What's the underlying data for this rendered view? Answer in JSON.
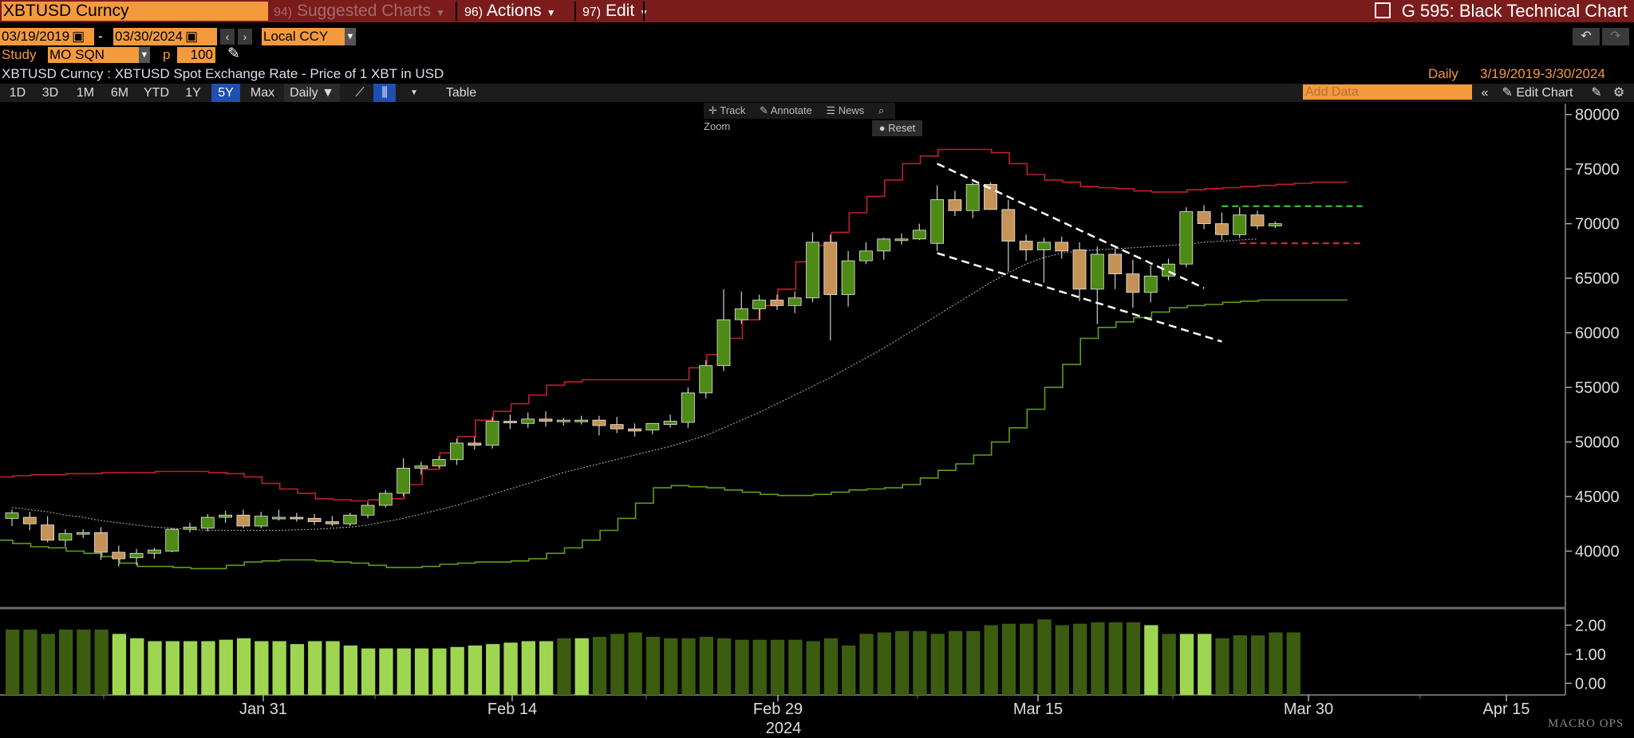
{
  "header": {
    "ticker": "XBTUSD Curncy",
    "menus": [
      {
        "num": "94)",
        "label": "Suggested Charts"
      },
      {
        "num": "96)",
        "label": "Actions"
      },
      {
        "num": "97)",
        "label": "Edit"
      }
    ],
    "function_title": "G 595: Black Technical Chart"
  },
  "controls": {
    "start_date": "03/19/2019",
    "date_sep": "-",
    "end_date": "03/30/2024",
    "currency": "Local CCY",
    "study_label": "Study",
    "study_value": "MO SQN",
    "p_label": "p",
    "p_value": "100",
    "undo": "↶",
    "redo": "↷"
  },
  "security_desc": "XBTUSD Curncy : XBTUSD Spot Exchange Rate - Price of 1 XBT in USD",
  "period_info": {
    "frequency": "Daily",
    "range": "3/19/2019-3/30/2024"
  },
  "toolbar": {
    "periods": [
      "1D",
      "3D",
      "1M",
      "6M",
      "YTD",
      "1Y",
      "5Y",
      "Max"
    ],
    "selected": "5Y",
    "frequency": "Daily ▼",
    "table": "Table",
    "add_data_placeholder": "Add Data",
    "edit_chart": "Edit Chart"
  },
  "chart_tools": {
    "track": "Track",
    "annotate": "Annotate",
    "news": "News",
    "zoom": "Zoom",
    "reset": "Reset"
  },
  "watermark": "MACRO OPS",
  "chart_data": {
    "type": "candlestick",
    "x_tick_labels": [
      "Jan 31",
      "Feb 14",
      "Feb 29",
      "Mar 15",
      "Mar 30",
      "Apr 15"
    ],
    "x_year_label": "2024",
    "y_ticks": [
      40000,
      45000,
      50000,
      55000,
      60000,
      65000,
      70000,
      75000,
      80000
    ],
    "ylim": [
      35000,
      81000
    ],
    "candles": [
      {
        "o": 43000,
        "h": 43800,
        "l": 42300,
        "c": 43500
      },
      {
        "o": 43100,
        "h": 43600,
        "l": 41900,
        "c": 42500
      },
      {
        "o": 42400,
        "h": 43200,
        "l": 40800,
        "c": 41000
      },
      {
        "o": 41000,
        "h": 42000,
        "l": 40400,
        "c": 41600
      },
      {
        "o": 41600,
        "h": 42000,
        "l": 41200,
        "c": 41700
      },
      {
        "o": 41700,
        "h": 42200,
        "l": 39200,
        "c": 39900
      },
      {
        "o": 39900,
        "h": 40500,
        "l": 38600,
        "c": 39300
      },
      {
        "o": 39400,
        "h": 40200,
        "l": 38700,
        "c": 39800
      },
      {
        "o": 39800,
        "h": 40300,
        "l": 39300,
        "c": 40100
      },
      {
        "o": 40000,
        "h": 42100,
        "l": 39900,
        "c": 42000
      },
      {
        "o": 42000,
        "h": 42600,
        "l": 41700,
        "c": 42200
      },
      {
        "o": 42100,
        "h": 43400,
        "l": 41800,
        "c": 43100
      },
      {
        "o": 43100,
        "h": 43700,
        "l": 42600,
        "c": 43300
      },
      {
        "o": 43300,
        "h": 43800,
        "l": 42100,
        "c": 42300
      },
      {
        "o": 42300,
        "h": 43600,
        "l": 42100,
        "c": 43200
      },
      {
        "o": 43100,
        "h": 43800,
        "l": 42800,
        "c": 43100
      },
      {
        "o": 43100,
        "h": 43500,
        "l": 42700,
        "c": 43000
      },
      {
        "o": 43000,
        "h": 43400,
        "l": 42400,
        "c": 42700
      },
      {
        "o": 42700,
        "h": 43200,
        "l": 42300,
        "c": 42500
      },
      {
        "o": 42500,
        "h": 43500,
        "l": 42300,
        "c": 43300
      },
      {
        "o": 43300,
        "h": 44500,
        "l": 43000,
        "c": 44200
      },
      {
        "o": 44200,
        "h": 45600,
        "l": 44000,
        "c": 45300
      },
      {
        "o": 45300,
        "h": 48500,
        "l": 45000,
        "c": 47600
      },
      {
        "o": 47600,
        "h": 48200,
        "l": 47000,
        "c": 47800
      },
      {
        "o": 47800,
        "h": 48700,
        "l": 47600,
        "c": 48400
      },
      {
        "o": 48400,
        "h": 50300,
        "l": 47900,
        "c": 49900
      },
      {
        "o": 49900,
        "h": 50500,
        "l": 49300,
        "c": 49700
      },
      {
        "o": 49700,
        "h": 52300,
        "l": 49400,
        "c": 51900
      },
      {
        "o": 51900,
        "h": 52500,
        "l": 51200,
        "c": 51800
      },
      {
        "o": 51700,
        "h": 52700,
        "l": 51300,
        "c": 52100
      },
      {
        "o": 52100,
        "h": 52800,
        "l": 51400,
        "c": 51900
      },
      {
        "o": 51900,
        "h": 52200,
        "l": 51500,
        "c": 52000
      },
      {
        "o": 52000,
        "h": 52400,
        "l": 51600,
        "c": 52000
      },
      {
        "o": 52000,
        "h": 52400,
        "l": 50600,
        "c": 51500
      },
      {
        "o": 51600,
        "h": 52300,
        "l": 50800,
        "c": 51200
      },
      {
        "o": 51200,
        "h": 51700,
        "l": 50500,
        "c": 51000
      },
      {
        "o": 51100,
        "h": 51500,
        "l": 50700,
        "c": 51700
      },
      {
        "o": 51600,
        "h": 52500,
        "l": 51300,
        "c": 51900
      },
      {
        "o": 51800,
        "h": 55000,
        "l": 51300,
        "c": 54500
      },
      {
        "o": 54500,
        "h": 57500,
        "l": 54000,
        "c": 57000
      },
      {
        "o": 57000,
        "h": 64000,
        "l": 56500,
        "c": 61200
      },
      {
        "o": 61200,
        "h": 63800,
        "l": 60800,
        "c": 62200
      },
      {
        "o": 62200,
        "h": 63500,
        "l": 61200,
        "c": 63000
      },
      {
        "o": 63000,
        "h": 63500,
        "l": 62100,
        "c": 62500
      },
      {
        "o": 62500,
        "h": 63800,
        "l": 61800,
        "c": 63200
      },
      {
        "o": 63200,
        "h": 69200,
        "l": 62800,
        "c": 68300
      },
      {
        "o": 68300,
        "h": 69000,
        "l": 59300,
        "c": 63500
      },
      {
        "o": 63500,
        "h": 67500,
        "l": 62400,
        "c": 66600
      },
      {
        "o": 66600,
        "h": 68300,
        "l": 66300,
        "c": 67500
      },
      {
        "o": 67500,
        "h": 68700,
        "l": 66700,
        "c": 68600
      },
      {
        "o": 68600,
        "h": 69100,
        "l": 68100,
        "c": 68600
      },
      {
        "o": 68600,
        "h": 70000,
        "l": 68500,
        "c": 69400
      },
      {
        "o": 68200,
        "h": 73500,
        "l": 67500,
        "c": 72200
      },
      {
        "o": 72200,
        "h": 73000,
        "l": 70700,
        "c": 71200
      },
      {
        "o": 71200,
        "h": 73800,
        "l": 70500,
        "c": 73600
      },
      {
        "o": 73600,
        "h": 73800,
        "l": 71300,
        "c": 71300
      },
      {
        "o": 71300,
        "h": 72200,
        "l": 65600,
        "c": 68400
      },
      {
        "o": 68400,
        "h": 69000,
        "l": 66600,
        "c": 67600
      },
      {
        "o": 67600,
        "h": 68700,
        "l": 64600,
        "c": 68300
      },
      {
        "o": 68300,
        "h": 68800,
        "l": 66800,
        "c": 67500
      },
      {
        "o": 67600,
        "h": 68300,
        "l": 62900,
        "c": 64000
      },
      {
        "o": 64000,
        "h": 67900,
        "l": 60800,
        "c": 67200
      },
      {
        "o": 67200,
        "h": 67700,
        "l": 64000,
        "c": 65400
      },
      {
        "o": 65400,
        "h": 66700,
        "l": 62300,
        "c": 63700
      },
      {
        "o": 63700,
        "h": 66200,
        "l": 62800,
        "c": 65200
      },
      {
        "o": 65200,
        "h": 66800,
        "l": 64800,
        "c": 66300
      },
      {
        "o": 66300,
        "h": 71500,
        "l": 66000,
        "c": 71100
      },
      {
        "o": 71100,
        "h": 71700,
        "l": 69500,
        "c": 70000
      },
      {
        "o": 70000,
        "h": 71000,
        "l": 68500,
        "c": 69000
      },
      {
        "o": 69000,
        "h": 71500,
        "l": 68700,
        "c": 70800
      },
      {
        "o": 70800,
        "h": 71200,
        "l": 69500,
        "c": 69800
      },
      {
        "o": 69800,
        "h": 70200,
        "l": 69600,
        "c": 70000
      }
    ],
    "upper_channel": [
      46800,
      46900,
      47000,
      47000,
      47100,
      47100,
      47200,
      47200,
      47200,
      47300,
      47300,
      47300,
      47200,
      47100,
      46800,
      46200,
      45700,
      45300,
      44800,
      44700,
      44600,
      44700,
      44800,
      46100,
      47500,
      49000,
      50500,
      52000,
      52800,
      53500,
      54300,
      55200,
      55500,
      55700,
      55700,
      55700,
      55700,
      55700,
      55700,
      56800,
      58000,
      59500,
      61200,
      62500,
      64000,
      66500,
      68000,
      69200,
      71000,
      72500,
      74000,
      75500,
      76200,
      76800,
      76800,
      76800,
      76500,
      75500,
      74500,
      74000,
      73800,
      73400,
      73300,
      73200,
      73000,
      72900,
      72900,
      73100,
      73200,
      73300,
      73400,
      73500,
      73600,
      73700,
      73800,
      73800
    ],
    "lower_channel": [
      41000,
      40700,
      40400,
      40300,
      40000,
      39800,
      39500,
      38900,
      38600,
      38600,
      38500,
      38400,
      38400,
      38700,
      39000,
      39100,
      39200,
      39200,
      39100,
      39000,
      38900,
      38700,
      38500,
      38500,
      38600,
      38800,
      38900,
      39000,
      39000,
      39100,
      39300,
      39800,
      40300,
      41000,
      41900,
      43000,
      44400,
      45800,
      46000,
      45900,
      45800,
      45600,
      45400,
      45200,
      45100,
      45100,
      45200,
      45400,
      45600,
      45700,
      45800,
      46100,
      46700,
      47400,
      48000,
      48800,
      50000,
      51300,
      53000,
      55000,
      57100,
      59500,
      60500,
      61000,
      61400,
      61900,
      62300,
      62500,
      62600,
      62800,
      62900,
      63000,
      63000,
      63000,
      63000,
      63000
    ],
    "moving_average": [
      44000,
      43800,
      43600,
      43300,
      43100,
      42800,
      42600,
      42400,
      42200,
      42100,
      42000,
      41900,
      41900,
      41900,
      41900,
      41900,
      41950,
      42000,
      42100,
      42200,
      42400,
      42700,
      43000,
      43400,
      43800,
      44200,
      44700,
      45200,
      45700,
      46200,
      46700,
      47200,
      47600,
      48000,
      48400,
      48800,
      49200,
      49600,
      50100,
      50600,
      51300,
      52000,
      52700,
      53500,
      54300,
      55100,
      55900,
      56800,
      57700,
      58600,
      59600,
      60600,
      61600,
      62600,
      63600,
      64600,
      65500,
      66300,
      66900,
      67300,
      67500,
      67600,
      67700,
      67800,
      67900,
      68000,
      68100,
      68300,
      68400,
      68500,
      68600
    ],
    "annotations": {
      "channel_upper": [
        [
          52,
          75500
        ],
        [
          67,
          64100
        ]
      ],
      "channel_lower": [
        [
          52,
          67300
        ],
        [
          68,
          59200
        ]
      ],
      "resistance": {
        "from": 68,
        "to": 75,
        "y": 71600
      },
      "support": {
        "from": 69,
        "to": 75,
        "y": 68200
      }
    },
    "indicator": {
      "name": "MO SQN",
      "y_ticks": [
        0,
        1,
        2
      ],
      "y_tick_labels": [
        "0.00",
        "1.00",
        "2.00"
      ],
      "ylim": [
        -0.4,
        2.45
      ],
      "values": [
        1.85,
        1.85,
        1.7,
        1.85,
        1.85,
        1.85,
        1.7,
        1.55,
        1.45,
        1.45,
        1.45,
        1.45,
        1.5,
        1.55,
        1.45,
        1.45,
        1.35,
        1.45,
        1.45,
        1.3,
        1.2,
        1.2,
        1.2,
        1.2,
        1.2,
        1.25,
        1.3,
        1.35,
        1.4,
        1.45,
        1.45,
        1.55,
        1.55,
        1.6,
        1.7,
        1.75,
        1.6,
        1.55,
        1.55,
        1.6,
        1.55,
        1.5,
        1.5,
        1.5,
        1.5,
        1.45,
        1.55,
        1.3,
        1.7,
        1.75,
        1.8,
        1.8,
        1.7,
        1.8,
        1.8,
        2.0,
        2.05,
        2.05,
        2.2,
        2.0,
        2.05,
        2.1,
        2.1,
        2.1,
        2.0,
        1.7,
        1.7,
        1.7,
        1.55,
        1.65,
        1.65,
        1.75,
        1.75
      ],
      "colors": [
        "#3c5c10",
        "#3c5c10",
        "#3c5c10",
        "#3c5c10",
        "#3c5c10",
        "#3c5c10",
        "#9ed651",
        "#9ed651",
        "#9ed651",
        "#9ed651",
        "#9ed651",
        "#9ed651",
        "#9ed651",
        "#9ed651",
        "#9ed651",
        "#9ed651",
        "#9ed651",
        "#9ed651",
        "#9ed651",
        "#9ed651",
        "#9ed651",
        "#9ed651",
        "#9ed651",
        "#9ed651",
        "#9ed651",
        "#9ed651",
        "#9ed651",
        "#9ed651",
        "#9ed651",
        "#9ed651",
        "#9ed651",
        "#3c5c10",
        "#9ed651",
        "#3c5c10",
        "#3c5c10",
        "#3c5c10",
        "#3c5c10",
        "#3c5c10",
        "#3c5c10",
        "#3c5c10",
        "#3c5c10",
        "#3c5c10",
        "#3c5c10",
        "#3c5c10",
        "#3c5c10",
        "#3c5c10",
        "#3c5c10",
        "#3c5c10",
        "#3c5c10",
        "#3c5c10",
        "#3c5c10",
        "#3c5c10",
        "#3c5c10",
        "#3c5c10",
        "#3c5c10",
        "#3c5c10",
        "#3c5c10",
        "#3c5c10",
        "#3c5c10",
        "#3c5c10",
        "#3c5c10",
        "#3c5c10",
        "#3c5c10",
        "#3c5c10",
        "#9ed651",
        "#3c5c10",
        "#9ed651",
        "#9ed651",
        "#3c5c10",
        "#3c5c10",
        "#3c5c10",
        "#3c5c10",
        "#3c5c10"
      ]
    },
    "colors": {
      "up_candle": "#4d8a16",
      "down_candle": "#c69356",
      "upper_channel": "#c0202a",
      "lower_channel": "#5f9e1a",
      "moving_average": "#9a9a9a",
      "resistance": "#3bd63b",
      "support": "#e03030"
    }
  }
}
